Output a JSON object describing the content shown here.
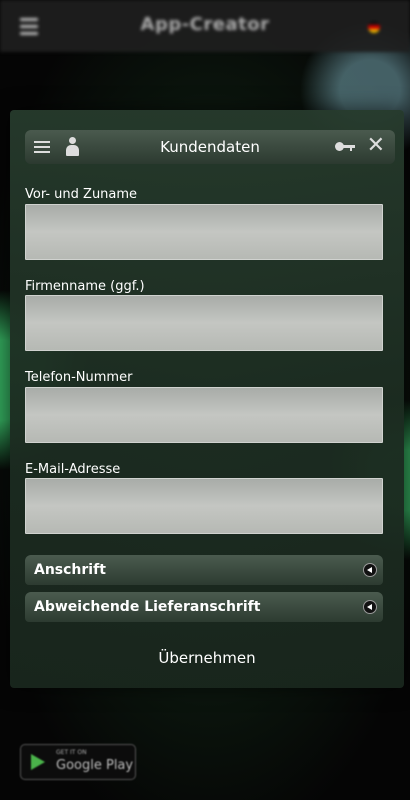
{
  "topbar": {
    "app_title": "App-Creator",
    "menu_icon": "hamburger-icon",
    "flag_icon": "german-flag-icon"
  },
  "dialog": {
    "title": "Kundendaten",
    "icons": [
      "hamburger-icon",
      "user-icon",
      "key-icon",
      "close-icon"
    ],
    "close_glyph": "✕",
    "fields": [
      {
        "label": "Vor- und Zuname",
        "value": "",
        "placeholder": ""
      },
      {
        "label": "Firmenname (ggf.)",
        "value": "",
        "placeholder": ""
      },
      {
        "label": "Telefon-Nummer",
        "value": "",
        "placeholder": ""
      },
      {
        "label": "E-Mail-Adresse",
        "value": "",
        "placeholder": ""
      }
    ],
    "sections": [
      {
        "label": "Anschrift"
      },
      {
        "label": "Abweichende Lieferanschrift"
      }
    ],
    "submit_label": "Übernehmen"
  },
  "badge": {
    "small_text": "GET IT ON",
    "big_text": "Google Play"
  },
  "colors": {
    "accent_green": "#3ca85a",
    "dialog_bg": "#263a2c",
    "input_bg": "#bfc1bd"
  }
}
